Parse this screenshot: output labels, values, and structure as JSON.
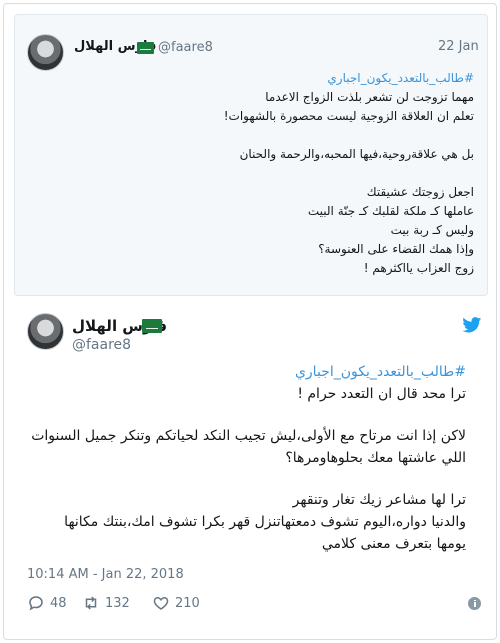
{
  "quoted_tweet": {
    "author_name": "فارس الهلال",
    "handle": "@faare8",
    "date": "22 Jan",
    "hashtag": "#طالب_بالتعدد_يكون_اجباري",
    "lines_1": [
      "مهما تزوجت لن تشعر بلذت الزواج الاعدما",
      "تعلم ان العلاقة الزوجية ليست محصورة بالشهوات!"
    ],
    "lines_2": [
      "بل هي علاقةروحية،فيها المحبه،والرحمة والحنان"
    ],
    "lines_3": [
      "اجعل زوجتك عشيقتك",
      "عاملها كـ ملكة لقلبك كـ جنّة البيت",
      "وليس كـ ربة بيت",
      "وإذا همك القضاء على العنوسة؟",
      "زوج العزاب يااكثرهم !"
    ]
  },
  "tweet": {
    "author_name": "فارس الهلال",
    "handle": "@faare8",
    "hashtag": "#طالب_بالتعدد_يكون_اجباري",
    "lines_1": [
      "ترا محد قال ان التعدد حرام !"
    ],
    "lines_2": [
      "لاكن إذا انت مرتاح مع الأولى،ليش تجيب النكد لحياتكم وتنكر جميل السنوات اللي عاشتها معك بحلوهاومرها؟"
    ],
    "lines_3": [
      "ترا لها مشاعر زيك تغار وتنقهر",
      "والدنيا دواره،اليوم تشوف دمعتهاتنزل قهر بكرا تشوف امك،بنتك مكانها",
      "يومها بتعرف معنى كلامي"
    ],
    "timestamp": "10:14 AM - Jan 22, 2018",
    "reply_count": "48",
    "retweet_count": "132",
    "like_count": "210"
  },
  "colors": {
    "link": "#3b94d9",
    "muted": "#657786",
    "twitter_blue": "#1da1f2",
    "flag_green": "#1c7a3c"
  },
  "icons": [
    "twitter-bird-icon",
    "reply-icon",
    "retweet-icon",
    "like-icon",
    "info-icon",
    "saudi-flag-icon"
  ]
}
